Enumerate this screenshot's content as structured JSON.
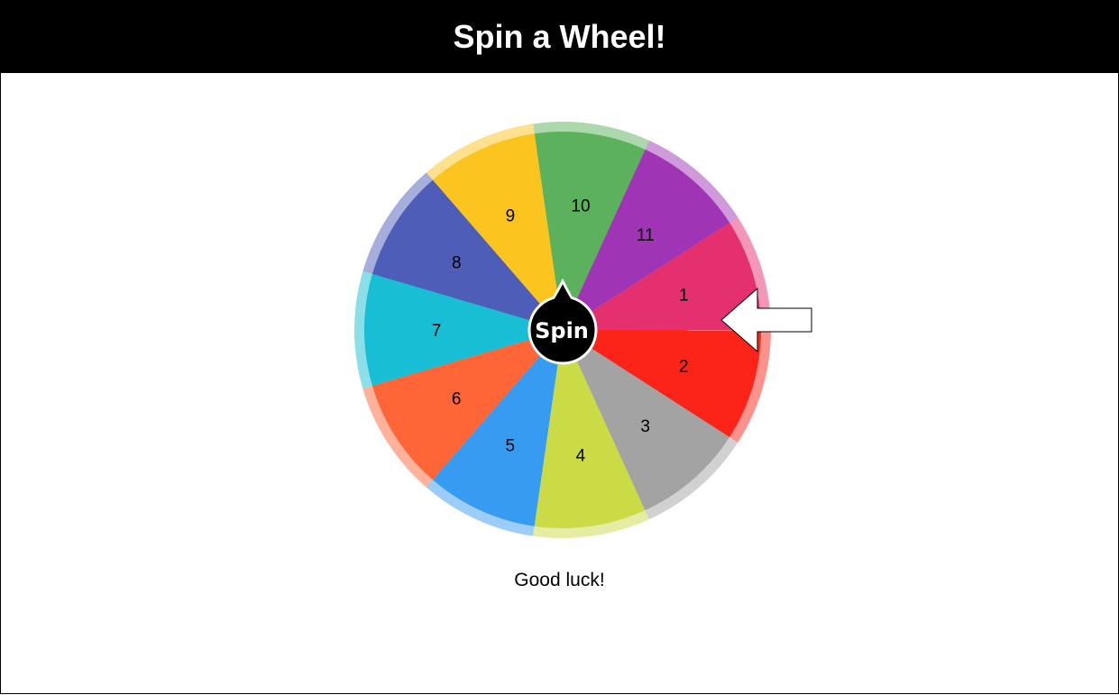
{
  "header": {
    "title": "Spin a Wheel!"
  },
  "wheel": {
    "center_button_label": "Spin",
    "segments": [
      {
        "label": "1",
        "color": "#E5306F"
      },
      {
        "label": "2",
        "color": "#FC2318"
      },
      {
        "label": "3",
        "color": "#A3A3A3"
      },
      {
        "label": "4",
        "color": "#CBDB46"
      },
      {
        "label": "5",
        "color": "#379CF1"
      },
      {
        "label": "6",
        "color": "#FE6537"
      },
      {
        "label": "7",
        "color": "#18BFD4"
      },
      {
        "label": "8",
        "color": "#4E5DB7"
      },
      {
        "label": "9",
        "color": "#FCC41E"
      },
      {
        "label": "10",
        "color": "#5CB25C"
      },
      {
        "label": "11",
        "color": "#9F35B5"
      }
    ]
  },
  "status": {
    "message": "Good luck!"
  },
  "colors": {
    "header_bg": "#000000",
    "pointer_fill": "#ffffff",
    "pointer_stroke": "#000000"
  }
}
